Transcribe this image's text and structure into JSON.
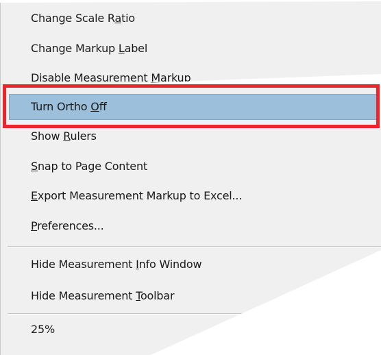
{
  "context_menu": {
    "items": [
      {
        "pre": "Change Scale R",
        "mn": "a",
        "post": "tio"
      },
      {
        "pre": "Change Markup ",
        "mn": "L",
        "post": "abel"
      },
      {
        "pre": "Disable Measurement ",
        "mn": "M",
        "post": "arkup"
      },
      {
        "pre": "Turn Ortho ",
        "mn": "O",
        "post": "ff"
      },
      {
        "pre": "Show ",
        "mn": "R",
        "post": "ulers"
      },
      {
        "pre": "",
        "mn": "S",
        "post": "nap to Page Content"
      },
      {
        "pre": "",
        "mn": "E",
        "post": "xport Measurement Markup to Excel..."
      },
      {
        "pre": "",
        "mn": "P",
        "post": "references..."
      },
      {
        "pre": "Hide Measurement ",
        "mn": "I",
        "post": "nfo Window"
      },
      {
        "pre": "Hide Measurement ",
        "mn": "T",
        "post": "oolbar"
      },
      {
        "pre": "",
        "mn": "",
        "post": "25%"
      }
    ],
    "highlighted_item": "Turn Ortho Off"
  },
  "colors": {
    "menu_background": "#f0f0f0",
    "highlight": "#9cc0dc",
    "annotation_box": "#e8262b"
  }
}
